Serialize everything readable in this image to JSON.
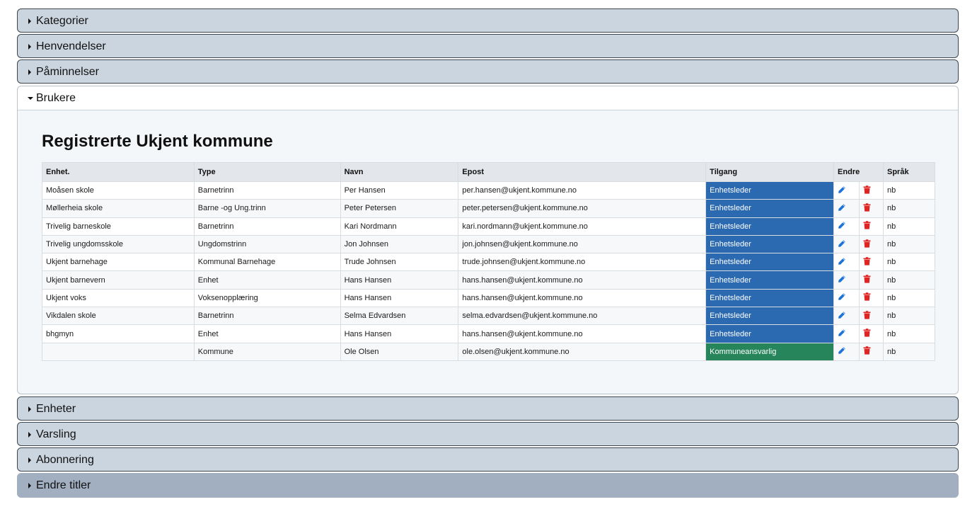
{
  "accordion": {
    "kategorier": "Kategorier",
    "henvendelser": "Henvendelser",
    "paminnelser": "Påminnelser",
    "brukere": "Brukere",
    "enheter": "Enheter",
    "varsling": "Varsling",
    "abonnering": "Abonnering",
    "endre_titler": "Endre titler"
  },
  "users": {
    "title": "Registrerte Ukjent kommune",
    "columns": [
      "Enhet.",
      "Type",
      "Navn",
      "Epost",
      "Tilgang",
      "Endre",
      "Språk"
    ],
    "rows": [
      {
        "enhet": "Moåsen skole",
        "type": "Barnetrinn",
        "navn": "Per Hansen",
        "epost": "per.hansen@ukjent.kommune.no",
        "tilgang": "Enhetsleder",
        "sprak": "nb"
      },
      {
        "enhet": "Møllerheia skole",
        "type": "Barne -og Ung.trinn",
        "navn": "Peter Petersen",
        "epost": "peter.petersen@ukjent.kommune.no",
        "tilgang": "Enhetsleder",
        "sprak": "nb"
      },
      {
        "enhet": "Trivelig barneskole",
        "type": "Barnetrinn",
        "navn": "Kari Nordmann",
        "epost": "kari.nordmann@ukjent.kommune.no",
        "tilgang": "Enhetsleder",
        "sprak": "nb"
      },
      {
        "enhet": "Trivelig ungdomsskole",
        "type": "Ungdomstrinn",
        "navn": "Jon Johnsen",
        "epost": "jon.johnsen@ukjent.kommune.no",
        "tilgang": "Enhetsleder",
        "sprak": "nb"
      },
      {
        "enhet": "Ukjent barnehage",
        "type": "Kommunal Barnehage",
        "navn": "Trude Johnsen",
        "epost": "trude.johnsen@ukjent.kommune.no",
        "tilgang": "Enhetsleder",
        "sprak": "nb"
      },
      {
        "enhet": "Ukjent barnevern",
        "type": "Enhet",
        "navn": "Hans Hansen",
        "epost": "hans.hansen@ukjent.kommune.no",
        "tilgang": "Enhetsleder",
        "sprak": "nb"
      },
      {
        "enhet": "Ukjent voks",
        "type": "Voksenopplæring",
        "navn": "Hans Hansen",
        "epost": "hans.hansen@ukjent.kommune.no",
        "tilgang": "Enhetsleder",
        "sprak": "nb"
      },
      {
        "enhet": "Vikdalen skole",
        "type": "Barnetrinn",
        "navn": "Selma Edvardsen",
        "epost": "selma.edvardsen@ukjent.kommune.no",
        "tilgang": "Enhetsleder",
        "sprak": "nb"
      },
      {
        "enhet": "bhgmyn",
        "type": "Enhet",
        "navn": "Hans Hansen",
        "epost": "hans.hansen@ukjent.kommune.no",
        "tilgang": "Enhetsleder",
        "sprak": "nb"
      },
      {
        "enhet": "",
        "type": "Kommune",
        "navn": "Ole Olsen",
        "epost": "ole.olsen@ukjent.kommune.no",
        "tilgang": "Kommuneansvarlig",
        "sprak": "nb"
      }
    ]
  },
  "colors": {
    "enhetsleder": "#2b69b0",
    "kommuneansvarlig": "#26855a",
    "edit_icon": "#1e73d8",
    "delete_icon": "#e02424"
  },
  "icons": {
    "collapsed": "caret-right-icon",
    "expanded": "caret-down-icon",
    "edit": "pencil-icon",
    "delete": "trash-icon"
  }
}
